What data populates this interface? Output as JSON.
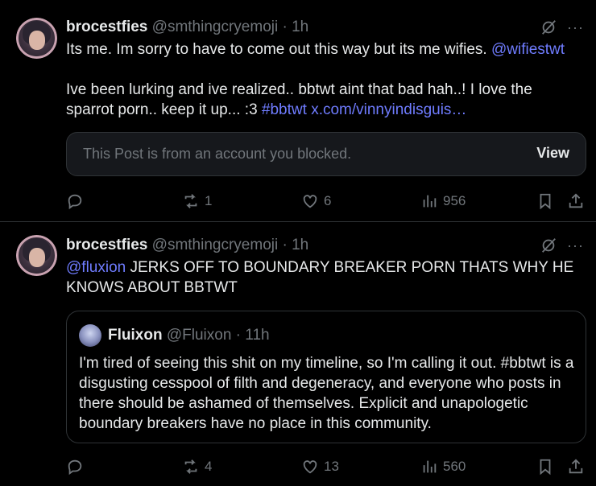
{
  "posts": [
    {
      "display_name": "brocestfies",
      "handle": "@smthingcryemoji",
      "separator": "·",
      "time": "1h",
      "more": "···",
      "text_line1_plain": "Its me. Im sorry to have to come out this way but its me wifies. ",
      "text_line1_mention": "@wifiestwt",
      "text_para2_plain": "Ive been lurking and ive realized.. bbtwt aint that bad hah..! I love the sparrot porn.. keep it up... :3 ",
      "text_para2_hashtag": "#bbtwt",
      "text_para2_link": "x.com/vinnyindisguis…",
      "blocked_notice": "This Post is from an account you blocked.",
      "view_label": "View",
      "stats": {
        "reposts": "1",
        "likes": "6",
        "views": "956"
      }
    },
    {
      "display_name": "brocestfies",
      "handle": "@smthingcryemoji",
      "separator": "·",
      "time": "1h",
      "more": "···",
      "text_mention": "@fluxion",
      "text_body": " JERKS OFF TO BOUNDARY BREAKER PORN THATS WHY HE KNOWS ABOUT BBTWT",
      "quote": {
        "display_name": "Fluixon",
        "handle": "@Fluixon",
        "separator": "·",
        "time": "11h",
        "text": "I'm tired of seeing this shit on my timeline, so I'm calling it out. #bbtwt is a disgusting cesspool of filth and degeneracy, and everyone who posts in there should be ashamed of themselves. Explicit and unapologetic boundary breakers have no place in this community."
      },
      "stats": {
        "reposts": "4",
        "likes": "13",
        "views": "560"
      }
    }
  ],
  "icons": [
    "reply-icon",
    "repost-icon",
    "like-icon",
    "views-icon",
    "bookmark-icon",
    "share-icon",
    "grok-icon",
    "more-icon"
  ],
  "colors": {
    "background": "#000000",
    "text": "#e7e9ea",
    "muted": "#71767b",
    "link": "#6f7cff",
    "border": "#2f3336"
  }
}
